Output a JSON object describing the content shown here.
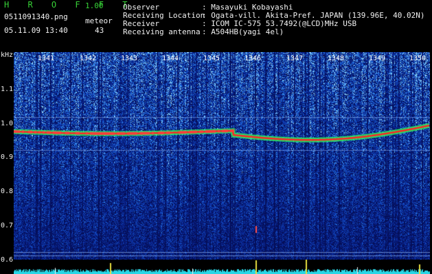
{
  "header": {
    "app_title": "H R O F F T",
    "version": "1.00",
    "filename": "0511091340.png",
    "mode_label": "meteor",
    "datetime": "05.11.09 13:40",
    "count": "43",
    "fields": [
      {
        "label": "Observer",
        "value": ": Masayuki Kobayashi"
      },
      {
        "label": "Receiving Location",
        "value": ": Ogata-vill. Akita-Pref. JAPAN (139.96E, 40.02N)"
      },
      {
        "label": "Receiver",
        "value": ": ICOM IC-575 53.7492(@LCD)MHz USB"
      },
      {
        "label": "Receiving antenna",
        "value": ": A504HB(yagi 4el)"
      }
    ]
  },
  "axis": {
    "unit": "kHz",
    "y_ticks": [
      "1.1",
      "1.0",
      "0.9",
      "0.8",
      "0.7",
      "0.6"
    ],
    "time_ticks": [
      "1341",
      "1342",
      "1343",
      "1344",
      "1345",
      "1346",
      "1347",
      "1348",
      "1349",
      "1350"
    ]
  },
  "colors": {
    "background": "#000000",
    "noise_dark": "#0a1a6a",
    "noise_mid": "#1e50c8",
    "noise_bright": "#5ab4ff",
    "signal": "#ff2020",
    "signal_edge": "#30ff60",
    "marker_line": "#8ab4ff"
  }
}
